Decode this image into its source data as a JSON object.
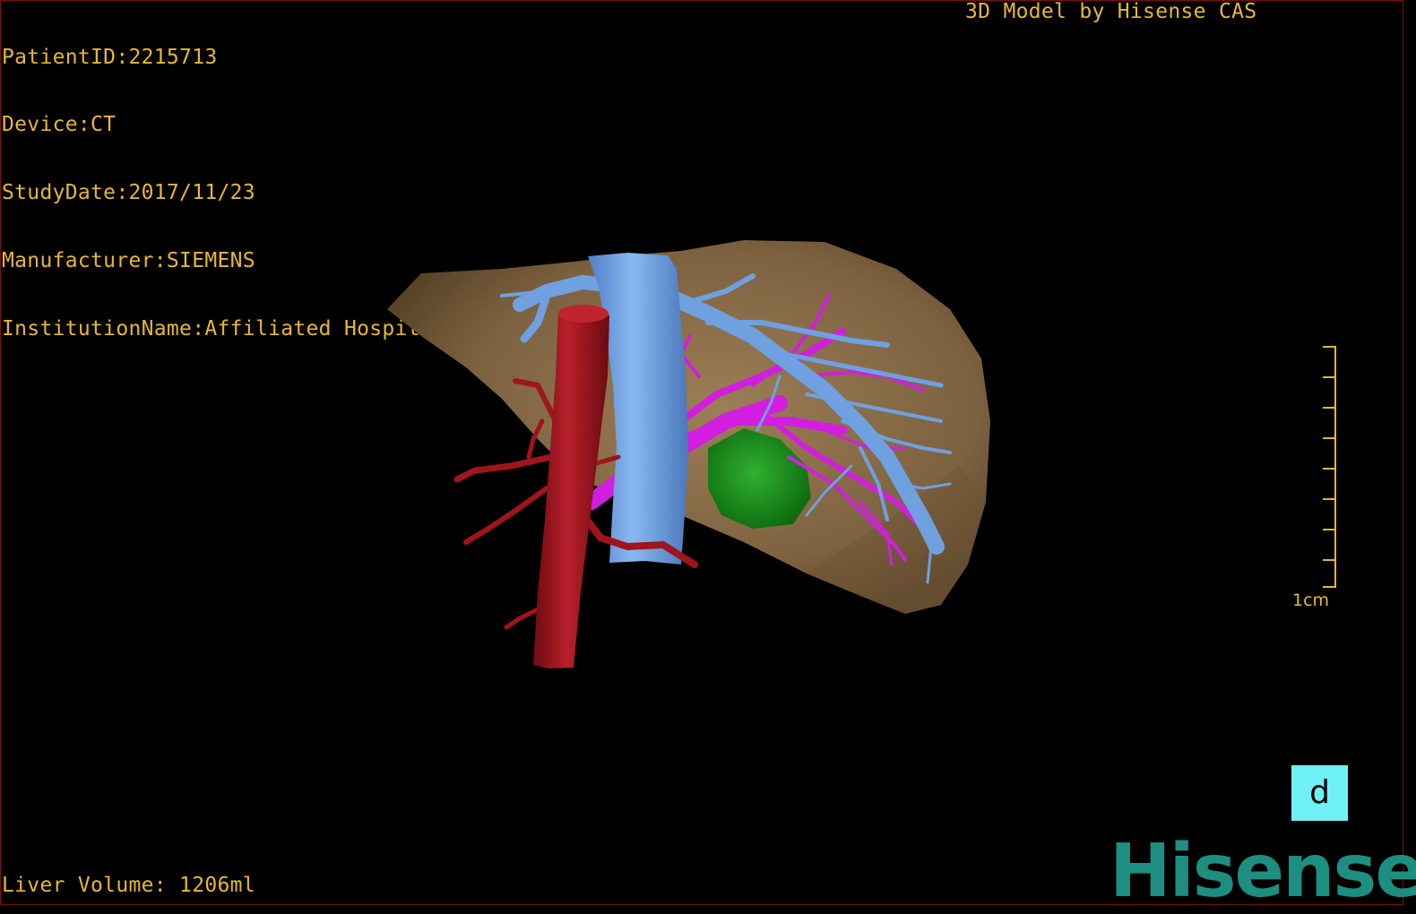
{
  "overlay": {
    "patient_id": "PatientID:2215713",
    "device": "Device:CT",
    "study_date": "StudyDate:2017/11/23",
    "manufacturer": "Manufacturer:SIEMENS",
    "institution": "InstitutionName:Affiliated Hospital Qingdao University-C",
    "credit": "3D Model by Hisense CAS",
    "liver_volume": "Liver Volume: 1206ml"
  },
  "scale_bar": {
    "label": "1cm"
  },
  "view_button": {
    "label": "d"
  },
  "logo": {
    "text": "Hisense"
  },
  "colors": {
    "overlay_text": "#e8b82a",
    "liver": "#8a6e4a",
    "portal_vein": "#6fa0e0",
    "artery": "#a0141c",
    "hepatic_vessels": "#d21ee0",
    "tumor": "#1a8a1a",
    "view_button": "#6ff0f5",
    "logo": "#1c8f80"
  }
}
